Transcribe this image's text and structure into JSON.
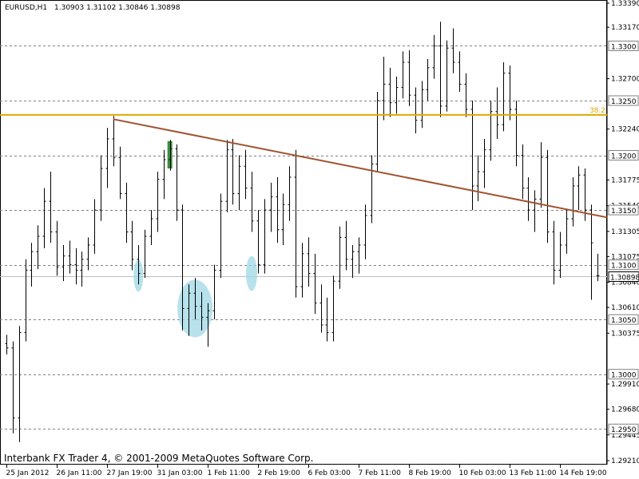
{
  "header": {
    "symbol": "EURUSD,H1",
    "quote": "1.30903 1.31102 1.30846 1.30898"
  },
  "watermark": "Interbank FX Trader 4, © 2001-2009 MetaQuotes Software Corp.",
  "colors": {
    "background": "#ffffff",
    "candles": "#000000",
    "fib_line": "#e0a800",
    "trend_line": "#a0522d",
    "grid": "#808080",
    "price_line": "#c0c0c0",
    "highlight": "#9fd8e6",
    "green_bar": "#3c8c3c"
  },
  "chart_data": {
    "type": "ohlc",
    "symbol": "EURUSD",
    "timeframe": "H1",
    "last_ohlc": {
      "open": 1.30903,
      "high": 1.31102,
      "low": 1.30846,
      "close": 1.30898
    },
    "ylim": [
      1.292,
      1.333
    ],
    "y_ticks": [
      "1.33390",
      "1.33170",
      "1.32700",
      "1.32240",
      "1.31775",
      "1.31540",
      "1.31305",
      "1.31075",
      "1.30840",
      "1.30610",
      "1.30375",
      "1.29910",
      "1.29680",
      "1.29445",
      "1.29210"
    ],
    "y_tick_values": [
      1.3339,
      1.3317,
      1.327,
      1.3224,
      1.31775,
      1.3154,
      1.31305,
      1.31075,
      1.3084,
      1.3061,
      1.30375,
      1.2991,
      1.2968,
      1.29445,
      1.2921
    ],
    "price_levels": [
      {
        "label": "1.3300",
        "value": 1.33
      },
      {
        "label": "1.3250",
        "value": 1.325
      },
      {
        "label": "1.3200",
        "value": 1.32
      },
      {
        "label": "1.3150",
        "value": 1.315
      },
      {
        "label": "1.3100",
        "value": 1.31
      },
      {
        "label": "1.3050",
        "value": 1.305
      },
      {
        "label": "1.3000",
        "value": 1.3
      },
      {
        "label": "1.2950",
        "value": 1.295
      }
    ],
    "current_price": {
      "label": "1.30898",
      "value": 1.30898
    },
    "fib_level": {
      "label": "38.2",
      "value": 1.3237
    },
    "trend_line": {
      "start": {
        "bar": 17,
        "price": 1.3233
      },
      "end": {
        "bar": 94,
        "price": 1.3145
      }
    },
    "highlights": [
      {
        "bar": 21,
        "price": 1.309
      },
      {
        "bar": 30,
        "price": 1.306
      },
      {
        "bar": 39,
        "price": 1.3092
      }
    ],
    "green_bar": {
      "bar": 26,
      "price_low": 1.3188,
      "price_high": 1.3213
    },
    "x_ticks": [
      {
        "label": "25 Jan 2012",
        "bar": 0
      },
      {
        "label": "26 Jan 11:00",
        "bar": 8
      },
      {
        "label": "27 Jan 19:00",
        "bar": 16
      },
      {
        "label": "31 Jan 03:00",
        "bar": 24
      },
      {
        "label": "1 Feb 11:00",
        "bar": 32
      },
      {
        "label": "2 Feb 19:00",
        "bar": 40
      },
      {
        "label": "6 Feb 03:00",
        "bar": 48
      },
      {
        "label": "7 Feb 11:00",
        "bar": 56
      },
      {
        "label": "8 Feb 19:00",
        "bar": 64
      },
      {
        "label": "10 Feb 03:00",
        "bar": 72
      },
      {
        "label": "13 Feb 11:00",
        "bar": 80
      },
      {
        "label": "14 Feb 19:00",
        "bar": 88
      }
    ],
    "bars": [
      {
        "o": 1.3028,
        "h": 1.3036,
        "l": 1.3018,
        "c": 1.3024
      },
      {
        "o": 1.3024,
        "h": 1.303,
        "l": 1.2946,
        "c": 1.296
      },
      {
        "o": 1.296,
        "h": 1.3044,
        "l": 1.2938,
        "c": 1.3038
      },
      {
        "o": 1.3038,
        "h": 1.3105,
        "l": 1.303,
        "c": 1.3095
      },
      {
        "o": 1.3095,
        "h": 1.312,
        "l": 1.308,
        "c": 1.3112
      },
      {
        "o": 1.3112,
        "h": 1.3136,
        "l": 1.3096,
        "c": 1.3126
      },
      {
        "o": 1.3126,
        "h": 1.317,
        "l": 1.3115,
        "c": 1.3158
      },
      {
        "o": 1.3158,
        "h": 1.3185,
        "l": 1.312,
        "c": 1.313
      },
      {
        "o": 1.313,
        "h": 1.314,
        "l": 1.309,
        "c": 1.3098
      },
      {
        "o": 1.3098,
        "h": 1.3118,
        "l": 1.3085,
        "c": 1.3108
      },
      {
        "o": 1.3108,
        "h": 1.3122,
        "l": 1.3092,
        "c": 1.31
      },
      {
        "o": 1.31,
        "h": 1.3115,
        "l": 1.3082,
        "c": 1.3095
      },
      {
        "o": 1.3095,
        "h": 1.3112,
        "l": 1.308,
        "c": 1.3105
      },
      {
        "o": 1.3105,
        "h": 1.3125,
        "l": 1.3095,
        "c": 1.3118
      },
      {
        "o": 1.3118,
        "h": 1.316,
        "l": 1.311,
        "c": 1.315
      },
      {
        "o": 1.315,
        "h": 1.32,
        "l": 1.314,
        "c": 1.3188
      },
      {
        "o": 1.3188,
        "h": 1.3225,
        "l": 1.317,
        "c": 1.3215
      },
      {
        "o": 1.3215,
        "h": 1.3236,
        "l": 1.319,
        "c": 1.3198
      },
      {
        "o": 1.3198,
        "h": 1.3208,
        "l": 1.316,
        "c": 1.3165
      },
      {
        "o": 1.3165,
        "h": 1.3175,
        "l": 1.312,
        "c": 1.313
      },
      {
        "o": 1.313,
        "h": 1.314,
        "l": 1.3095,
        "c": 1.3105
      },
      {
        "o": 1.3105,
        "h": 1.3118,
        "l": 1.3082,
        "c": 1.3092
      },
      {
        "o": 1.3092,
        "h": 1.3132,
        "l": 1.3088,
        "c": 1.3126
      },
      {
        "o": 1.3126,
        "h": 1.315,
        "l": 1.3118,
        "c": 1.3142
      },
      {
        "o": 1.3142,
        "h": 1.3185,
        "l": 1.313,
        "c": 1.3178
      },
      {
        "o": 1.3178,
        "h": 1.3205,
        "l": 1.316,
        "c": 1.3196
      },
      {
        "o": 1.3196,
        "h": 1.3214,
        "l": 1.3186,
        "c": 1.3206
      },
      {
        "o": 1.3206,
        "h": 1.321,
        "l": 1.314,
        "c": 1.315
      },
      {
        "o": 1.315,
        "h": 1.3155,
        "l": 1.304,
        "c": 1.306
      },
      {
        "o": 1.306,
        "h": 1.3082,
        "l": 1.3035,
        "c": 1.3074
      },
      {
        "o": 1.3074,
        "h": 1.3088,
        "l": 1.305,
        "c": 1.3062
      },
      {
        "o": 1.3062,
        "h": 1.3075,
        "l": 1.304,
        "c": 1.3052
      },
      {
        "o": 1.3052,
        "h": 1.3065,
        "l": 1.3025,
        "c": 1.3058
      },
      {
        "o": 1.3058,
        "h": 1.31,
        "l": 1.305,
        "c": 1.3095
      },
      {
        "o": 1.3095,
        "h": 1.3165,
        "l": 1.3088,
        "c": 1.3158
      },
      {
        "o": 1.3158,
        "h": 1.3214,
        "l": 1.3148,
        "c": 1.3205
      },
      {
        "o": 1.3205,
        "h": 1.3215,
        "l": 1.3155,
        "c": 1.3165
      },
      {
        "o": 1.3165,
        "h": 1.32,
        "l": 1.315,
        "c": 1.319
      },
      {
        "o": 1.319,
        "h": 1.3205,
        "l": 1.316,
        "c": 1.317
      },
      {
        "o": 1.317,
        "h": 1.3185,
        "l": 1.313,
        "c": 1.314
      },
      {
        "o": 1.314,
        "h": 1.315,
        "l": 1.3092,
        "c": 1.31
      },
      {
        "o": 1.31,
        "h": 1.316,
        "l": 1.3092,
        "c": 1.315
      },
      {
        "o": 1.315,
        "h": 1.3175,
        "l": 1.313,
        "c": 1.3162
      },
      {
        "o": 1.3162,
        "h": 1.318,
        "l": 1.312,
        "c": 1.3132
      },
      {
        "o": 1.3132,
        "h": 1.3165,
        "l": 1.3118,
        "c": 1.3155
      },
      {
        "o": 1.3155,
        "h": 1.319,
        "l": 1.314,
        "c": 1.318
      },
      {
        "o": 1.318,
        "h": 1.3205,
        "l": 1.307,
        "c": 1.308
      },
      {
        "o": 1.308,
        "h": 1.312,
        "l": 1.307,
        "c": 1.311
      },
      {
        "o": 1.311,
        "h": 1.3125,
        "l": 1.308,
        "c": 1.3092
      },
      {
        "o": 1.3092,
        "h": 1.311,
        "l": 1.3055,
        "c": 1.3065
      },
      {
        "o": 1.3065,
        "h": 1.3082,
        "l": 1.3038,
        "c": 1.3045
      },
      {
        "o": 1.3045,
        "h": 1.307,
        "l": 1.303,
        "c": 1.3038
      },
      {
        "o": 1.3038,
        "h": 1.309,
        "l": 1.303,
        "c": 1.3085
      },
      {
        "o": 1.3085,
        "h": 1.3135,
        "l": 1.3078,
        "c": 1.3125
      },
      {
        "o": 1.3125,
        "h": 1.314,
        "l": 1.3095,
        "c": 1.3105
      },
      {
        "o": 1.3105,
        "h": 1.3118,
        "l": 1.3088,
        "c": 1.3112
      },
      {
        "o": 1.3112,
        "h": 1.3125,
        "l": 1.3092,
        "c": 1.3118
      },
      {
        "o": 1.3118,
        "h": 1.3155,
        "l": 1.3105,
        "c": 1.3145
      },
      {
        "o": 1.3145,
        "h": 1.32,
        "l": 1.3138,
        "c": 1.3192
      },
      {
        "o": 1.3192,
        "h": 1.3258,
        "l": 1.3185,
        "c": 1.325
      },
      {
        "o": 1.325,
        "h": 1.329,
        "l": 1.3232,
        "c": 1.3265
      },
      {
        "o": 1.3265,
        "h": 1.328,
        "l": 1.3235,
        "c": 1.3248
      },
      {
        "o": 1.3248,
        "h": 1.3272,
        "l": 1.3238,
        "c": 1.3262
      },
      {
        "o": 1.3262,
        "h": 1.3295,
        "l": 1.3252,
        "c": 1.3285
      },
      {
        "o": 1.3285,
        "h": 1.3296,
        "l": 1.3245,
        "c": 1.3255
      },
      {
        "o": 1.3255,
        "h": 1.3262,
        "l": 1.322,
        "c": 1.3232
      },
      {
        "o": 1.3232,
        "h": 1.3268,
        "l": 1.3225,
        "c": 1.326
      },
      {
        "o": 1.326,
        "h": 1.3288,
        "l": 1.325,
        "c": 1.328
      },
      {
        "o": 1.328,
        "h": 1.331,
        "l": 1.327,
        "c": 1.33
      },
      {
        "o": 1.33,
        "h": 1.3322,
        "l": 1.3235,
        "c": 1.3245
      },
      {
        "o": 1.3245,
        "h": 1.3305,
        "l": 1.324,
        "c": 1.3298
      },
      {
        "o": 1.3298,
        "h": 1.3316,
        "l": 1.3275,
        "c": 1.3285
      },
      {
        "o": 1.3285,
        "h": 1.3295,
        "l": 1.3258,
        "c": 1.3265
      },
      {
        "o": 1.3265,
        "h": 1.3275,
        "l": 1.3235,
        "c": 1.3242
      },
      {
        "o": 1.3242,
        "h": 1.325,
        "l": 1.315,
        "c": 1.3172
      },
      {
        "o": 1.3172,
        "h": 1.32,
        "l": 1.3158,
        "c": 1.3185
      },
      {
        "o": 1.3185,
        "h": 1.3215,
        "l": 1.317,
        "c": 1.3205
      },
      {
        "o": 1.3205,
        "h": 1.325,
        "l": 1.3195,
        "c": 1.324
      },
      {
        "o": 1.324,
        "h": 1.3262,
        "l": 1.3215,
        "c": 1.3228
      },
      {
        "o": 1.3228,
        "h": 1.3285,
        "l": 1.3222,
        "c": 1.3275
      },
      {
        "o": 1.3275,
        "h": 1.3282,
        "l": 1.3232,
        "c": 1.3242
      },
      {
        "o": 1.3242,
        "h": 1.325,
        "l": 1.319,
        "c": 1.32
      },
      {
        "o": 1.32,
        "h": 1.321,
        "l": 1.316,
        "c": 1.317
      },
      {
        "o": 1.317,
        "h": 1.318,
        "l": 1.314,
        "c": 1.315
      },
      {
        "o": 1.315,
        "h": 1.3168,
        "l": 1.313,
        "c": 1.316
      },
      {
        "o": 1.316,
        "h": 1.3212,
        "l": 1.3152,
        "c": 1.3198
      },
      {
        "o": 1.3198,
        "h": 1.3205,
        "l": 1.312,
        "c": 1.313
      },
      {
        "o": 1.313,
        "h": 1.314,
        "l": 1.3082,
        "c": 1.3095
      },
      {
        "o": 1.3095,
        "h": 1.313,
        "l": 1.3088,
        "c": 1.3118
      },
      {
        "o": 1.3118,
        "h": 1.315,
        "l": 1.311,
        "c": 1.3142
      },
      {
        "o": 1.3142,
        "h": 1.318,
        "l": 1.3135,
        "c": 1.3172
      },
      {
        "o": 1.3172,
        "h": 1.319,
        "l": 1.315,
        "c": 1.3182
      },
      {
        "o": 1.3182,
        "h": 1.3188,
        "l": 1.314,
        "c": 1.315
      },
      {
        "o": 1.315,
        "h": 1.3155,
        "l": 1.3068,
        "c": 1.312
      },
      {
        "o": 1.309,
        "h": 1.311,
        "l": 1.3085,
        "c": 1.309
      }
    ]
  }
}
